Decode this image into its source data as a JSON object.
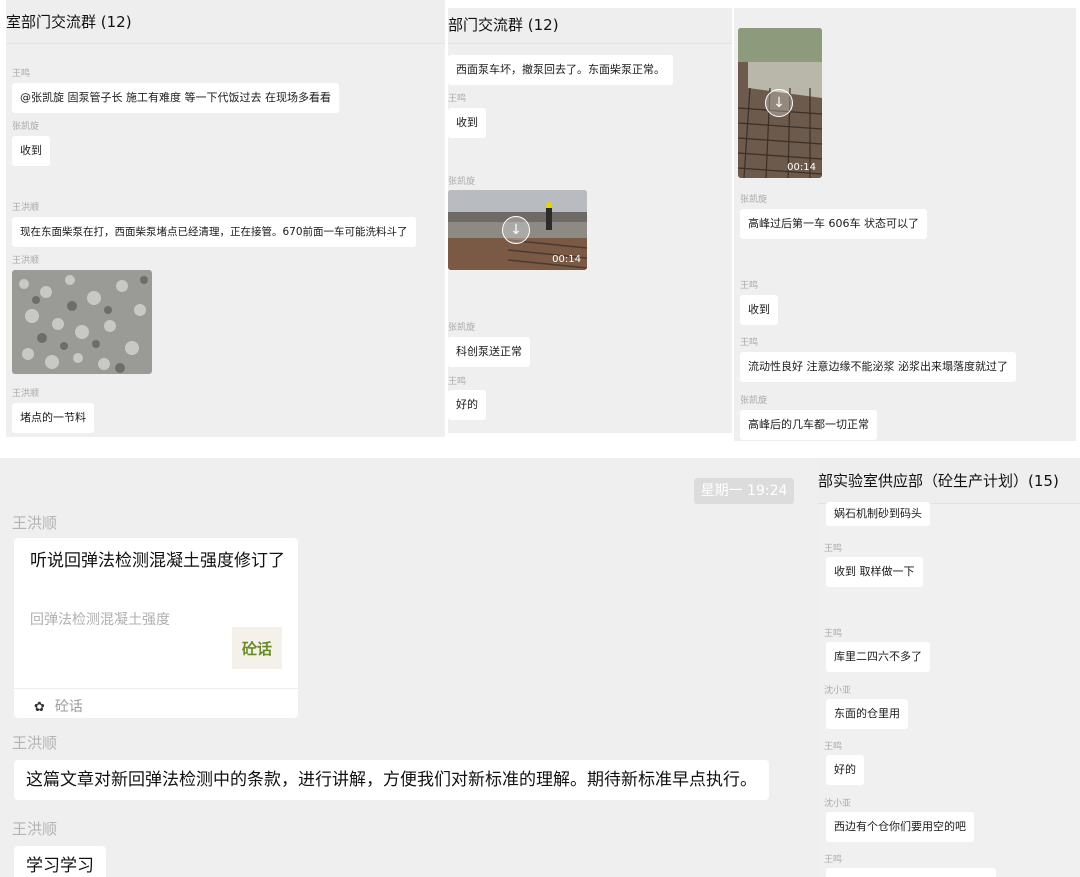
{
  "panel1": {
    "title": "室部门交流群 (12)",
    "messages": [
      {
        "sender": "王鸣",
        "text": "@张凯旋  固泵管子长 施工有难度  等一下代饭过去 在现场多看看"
      },
      {
        "sender": "张凯旋",
        "text": "收到"
      },
      {
        "sender": "王洪顺",
        "text": "现在东面柴泵在打，西面柴泵堵点已经清理，正在接管。670前面一车可能洗料斗了"
      },
      {
        "sender": "王洪顺",
        "image": "gravel-photo"
      },
      {
        "sender": "王洪顺",
        "text": "堵点的一节料"
      }
    ]
  },
  "panel2": {
    "title": "部门交流群 (12)",
    "messages": [
      {
        "text": "西面泵车坏，撤泵回去了。东面柴泵正常。"
      },
      {
        "sender": "王鸣",
        "text": "收到"
      },
      {
        "sender": "张凯旋",
        "video_duration": "00:14"
      },
      {
        "sender": "张凯旋",
        "text": "科创泵送正常"
      },
      {
        "sender": "王鸣",
        "text": "好的"
      }
    ]
  },
  "panel3": {
    "messages": [
      {
        "video_duration": "00:14"
      },
      {
        "sender": "张凯旋",
        "text": "高峰过后第一车 606车 状态可以了"
      },
      {
        "sender": "王鸣",
        "text": "收到"
      },
      {
        "sender": "王鸣",
        "text": "流动性良好  注意边缘不能泌浆  泌浆出来塌落度就过了"
      },
      {
        "sender": "张凯旋",
        "text": "高峰后的几车都一切正常"
      }
    ]
  },
  "panel4": {
    "time": "星期一 19:24",
    "card": {
      "sender": "王洪顺",
      "title": "听说回弹法检测混凝土强度修订了",
      "desc": "回弹法检测混凝土强度",
      "thumb_text": "砼话",
      "source": "砼话"
    },
    "messages": [
      {
        "sender": "王洪顺",
        "text": "这篇文章对新回弹法检测中的条款，进行讲解，方便我们对新标准的理解。期待新标准早点执行。"
      },
      {
        "sender": "王洪顺",
        "text": "学习学习"
      }
    ]
  },
  "panel5": {
    "title": "部实验室供应部（砼生产计划）(15)",
    "messages": [
      {
        "text": "娲石机制砂到码头"
      },
      {
        "sender": "王鸣",
        "text": "收到  取样做一下"
      },
      {
        "sender": "王鸣",
        "text": "库里二四六不多了"
      },
      {
        "sender": "沈小亚",
        "text": "东面的仓里用"
      },
      {
        "sender": "王鸣",
        "text": "好的"
      },
      {
        "sender": "沈小亚",
        "text": "西边有个仓你们要用空的吧"
      },
      {
        "sender": "王鸣"
      }
    ]
  },
  "colors": {
    "bubble": "#ffffff",
    "background": "#efefef",
    "download_overlay": "#ffffff"
  },
  "icons": {
    "download": "download-icon",
    "thumb": "tonghua-logo-icon"
  }
}
